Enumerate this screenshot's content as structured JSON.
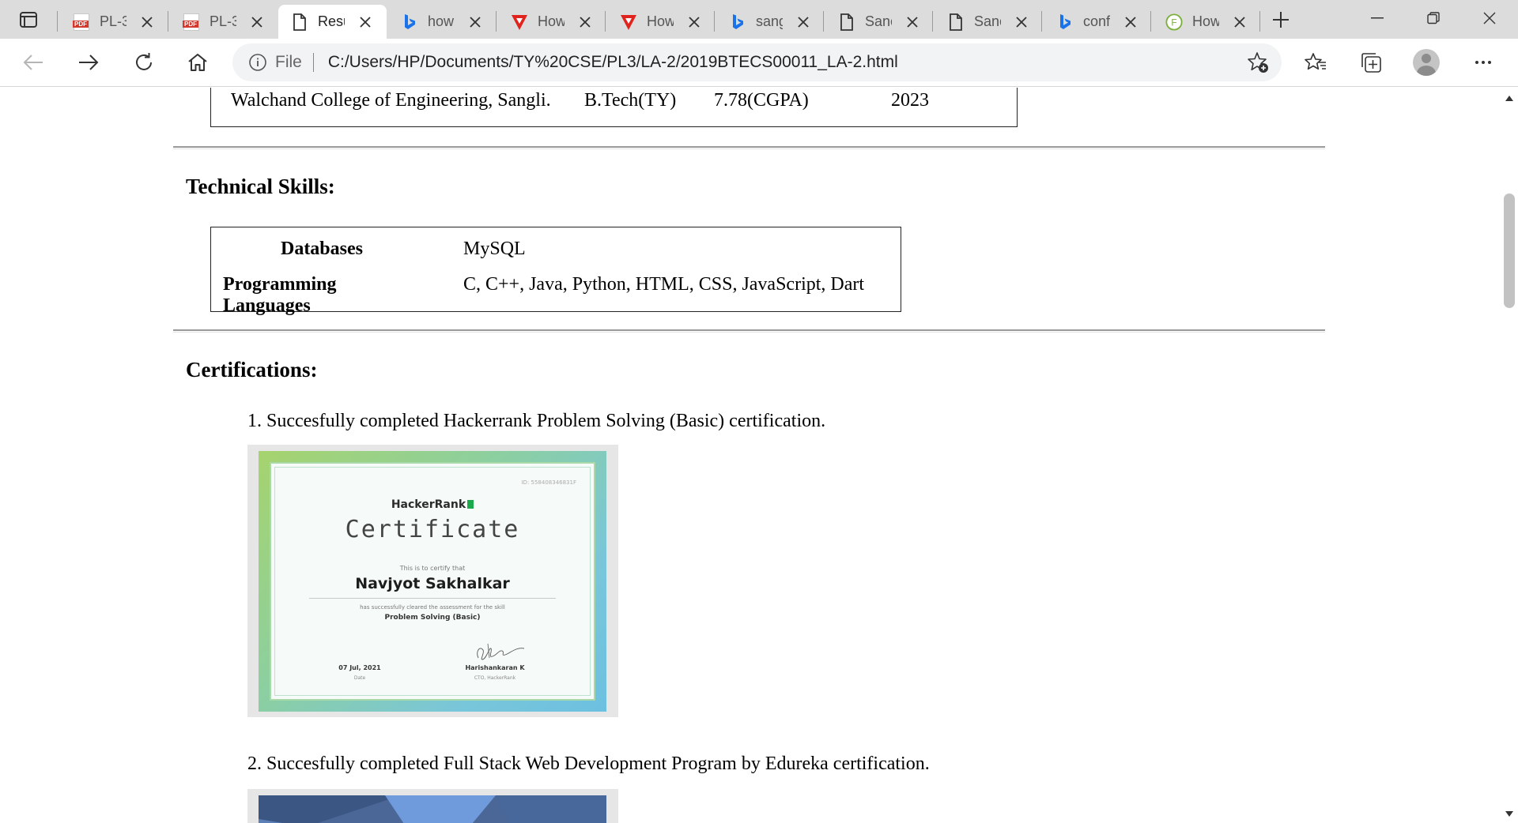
{
  "browser": {
    "tabs": [
      {
        "icon": "pdf-icon",
        "label": "PL-3",
        "active": false
      },
      {
        "icon": "pdf-icon",
        "label": "PL-3",
        "active": false
      },
      {
        "icon": "document-icon",
        "label": "Resu",
        "active": true
      },
      {
        "icon": "bing-icon",
        "label": "how",
        "active": false
      },
      {
        "icon": "vedantu-icon",
        "label": "How",
        "active": false
      },
      {
        "icon": "vedantu-icon",
        "label": "How",
        "active": false
      },
      {
        "icon": "bing-icon",
        "label": "sang",
        "active": false
      },
      {
        "icon": "document-icon",
        "label": "Sanc",
        "active": false
      },
      {
        "icon": "document-icon",
        "label": "Sanc",
        "active": false
      },
      {
        "icon": "bing-icon",
        "label": "conf",
        "active": false
      },
      {
        "icon": "f-icon",
        "label": "How",
        "active": false
      }
    ],
    "address": {
      "scheme_label": "File",
      "url": "C:/Users/HP/Documents/TY%20CSE/PL3/LA-2/2019BTECS00011_LA-2.html"
    },
    "colors": {
      "accent_pdf": "#d3382c",
      "bing": "#1a73e8",
      "vedantu": "#e0231c"
    }
  },
  "page": {
    "education_row": {
      "institute": "Walchand College of Engineering, Sangli.",
      "degree": "B.Tech(TY)",
      "score": "7.78(CGPA)",
      "year": "2023"
    },
    "skills_heading": "Technical Skills:",
    "skills": [
      {
        "label": "Databases",
        "value": "MySQL"
      },
      {
        "label": "Programming Languages",
        "value": "C, C++, Java, Python, HTML, CSS, JavaScript, Dart"
      }
    ],
    "certifications_heading": "Certifications:",
    "certifications": [
      {
        "text": "1. Succesfully completed Hackerrank Problem Solving (Basic) certification."
      },
      {
        "text": "2. Succesfully completed Full Stack Web Development Program by Edureka certification."
      }
    ],
    "hackerrank_certificate": {
      "id": "ID: 558408346831F",
      "brand": "HackerRank",
      "title": "Certificate",
      "certify_text": "This is to certify that",
      "name": "Navjyot Sakhalkar",
      "assessment_text": "has successfully cleared the assessment for the skill",
      "skill": "Problem Solving (Basic)",
      "date": "07 Jul, 2021",
      "date_label": "Date",
      "signer": "Harishankaran K",
      "signer_role": "CTO, HackerRank"
    }
  }
}
